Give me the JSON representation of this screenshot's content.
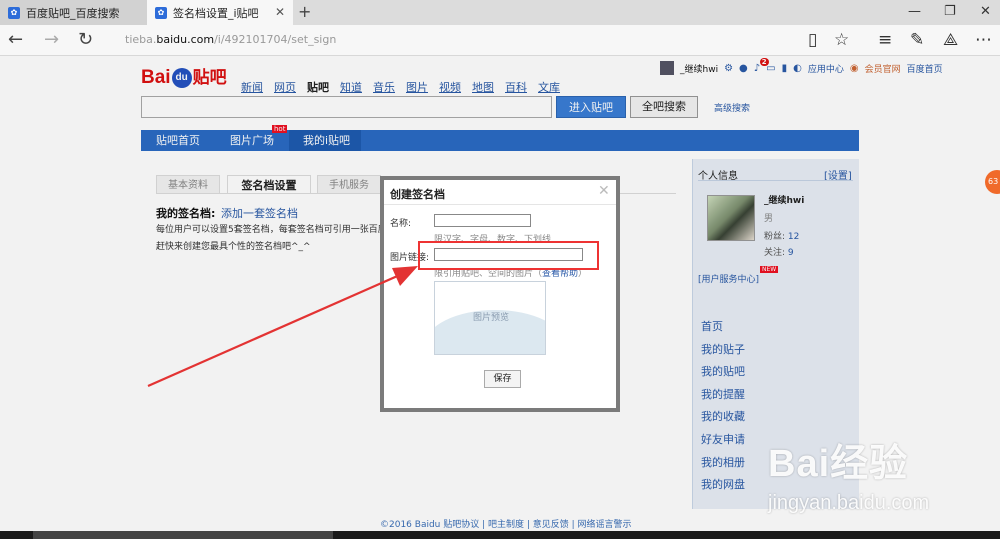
{
  "browser": {
    "tabs": [
      {
        "title": "百度贴吧_百度搜索"
      },
      {
        "title": "签名档设置_i贴吧"
      }
    ],
    "url_host": "tieba.baidu.com",
    "url_prefix": "tieba.",
    "url_domain": "baidu.com",
    "url_path": "/i/492101704/set_sign"
  },
  "header": {
    "logo_main": "Bai",
    "logo_paw": "du",
    "logo_tieba": "贴吧",
    "nav": [
      "新闻",
      "网页",
      "贴吧",
      "知道",
      "音乐",
      "图片",
      "视频",
      "地图",
      "百科",
      "文库"
    ],
    "nav_current": "贴吧",
    "enter_button": "进入贴吧",
    "search_all_button": "全吧搜索",
    "advanced_search": "高级搜索",
    "user_name": "_继续hwi",
    "notify_count": "2",
    "apps": "应用中心",
    "vip": "会员官网",
    "home": "百度首页"
  },
  "bluenav": {
    "home": "贴吧首页",
    "pics": "图片广场",
    "mine": "我的i贴吧",
    "hot_badge": "hot"
  },
  "settings": {
    "tabs": [
      "基本资料",
      "签名档设置",
      "手机服务"
    ],
    "my_sign_label": "我的签名档:",
    "add_sign": "添加一套签名档",
    "desc_line1": "每位用户可以设置5套签名档，每套签名档可引用一张百度贴",
    "desc_line2": "赶快来创建您最具个性的签名档吧^_^"
  },
  "sidebar": {
    "title": "个人信息",
    "settings_link": "[设置]",
    "name": "_继续hwi",
    "gender": "男",
    "fans_label": "粉丝:",
    "fans": "12",
    "follow_label": "关注:",
    "follow": "9",
    "service": "[用户服务中心]",
    "new_badge": "NEW",
    "links": [
      "首页",
      "我的贴子",
      "我的贴吧",
      "我的提醒",
      "我的收藏",
      "好友申请",
      "我的相册",
      "我的网盘"
    ]
  },
  "footer": {
    "text": "©2016 Baidu 贴吧协议 | 吧主制度 | 意见反馈 | 网络谣言警示"
  },
  "modal": {
    "title": "创建签名档",
    "name_label": "名称:",
    "name_value": "",
    "name_hint": "限汉字、字母、数字、下划线",
    "url_label": "图片链接:",
    "url_value": "",
    "url_hint_prefix": "限引用贴吧、空间的图片（",
    "url_hint_link": "查看帮助",
    "url_hint_suffix": "）",
    "preview": "图片预览",
    "save": "保存"
  },
  "watermark": {
    "brand": "Bai经验",
    "url": "jingyan.baidu.com"
  },
  "floating_badge": "63",
  "colors": {
    "blue_nav": "#2b6bc4",
    "link": "#2a5aa8",
    "annotation": "#e33333",
    "logo_red": "#dd1111"
  }
}
